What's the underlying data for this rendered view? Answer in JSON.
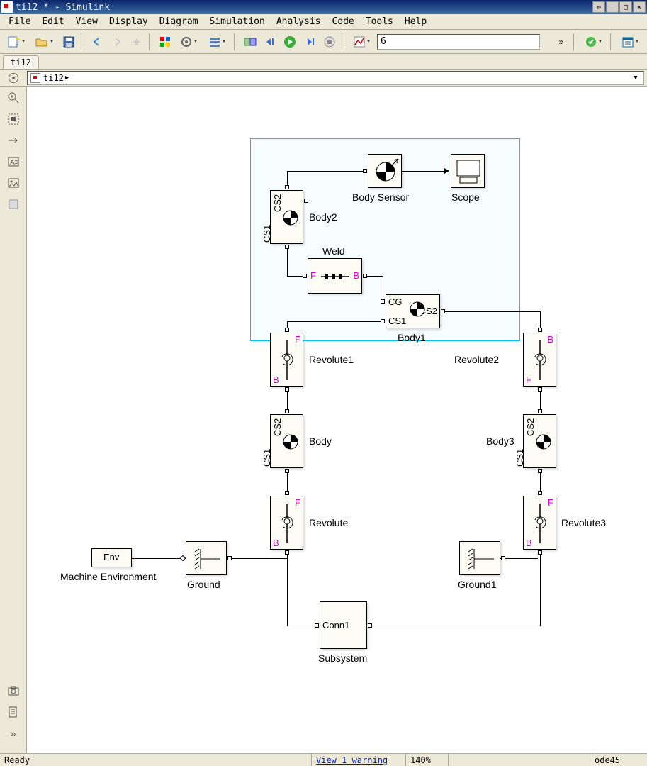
{
  "window": {
    "title": "ti12 * - Simulink"
  },
  "menu": {
    "file": "File",
    "edit": "Edit",
    "view": "View",
    "display": "Display",
    "diagram": "Diagram",
    "simulation": "Simulation",
    "analysis": "Analysis",
    "code": "Code",
    "tools": "Tools",
    "help": "Help"
  },
  "toolbar": {
    "sim_time": "6"
  },
  "tab": {
    "name": "ti12"
  },
  "breadcrumb": {
    "root": "ti12"
  },
  "blocks": {
    "env": {
      "port": "Env",
      "label": "Machine Environment"
    },
    "ground": {
      "label": "Ground"
    },
    "ground1": {
      "label": "Ground1"
    },
    "revolute": {
      "label": "Revolute"
    },
    "revolute1": {
      "label": "Revolute1"
    },
    "revolute2": {
      "label": "Revolute2"
    },
    "revolute3": {
      "label": "Revolute3"
    },
    "body": {
      "label": "Body",
      "p1": "CS1",
      "p2": "CS2"
    },
    "body1": {
      "label": "Body1",
      "p_cg": "CG",
      "p_cs1": "CS1",
      "p_cs2": "CS2"
    },
    "body2": {
      "label": "Body2",
      "p1": "CS1",
      "p2": "CS2"
    },
    "body3": {
      "label": "Body3",
      "p1": "CS1",
      "p2": "CS2"
    },
    "weld": {
      "label": "Weld",
      "f": "F",
      "b": "B"
    },
    "bodysensor": {
      "label": "Body Sensor"
    },
    "scope": {
      "label": "Scope"
    },
    "subsystem": {
      "label": "Subsystem",
      "port": "Conn1"
    }
  },
  "revolute_ports": {
    "f": "F",
    "b": "B"
  },
  "status": {
    "ready": "Ready",
    "warning": "View 1 warning",
    "zoom": "140%",
    "solver": "ode45"
  }
}
